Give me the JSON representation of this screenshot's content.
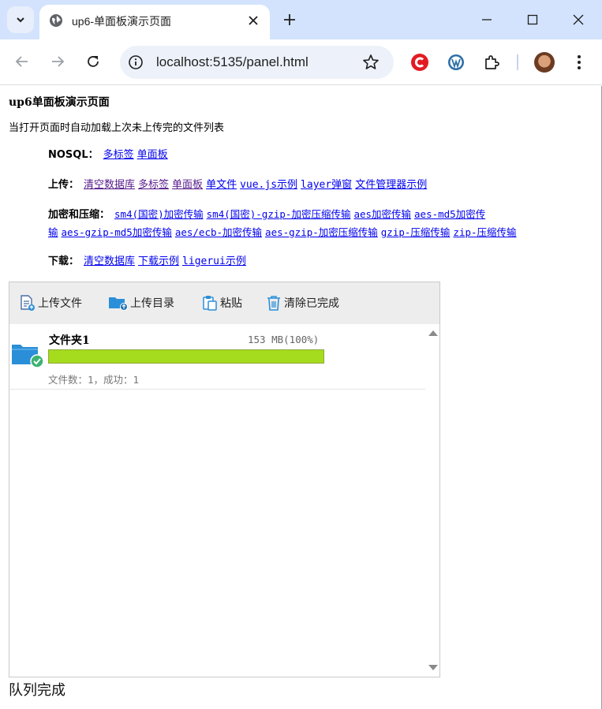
{
  "browser": {
    "tab_title": "up6-单面板演示页面",
    "url": "localhost:5135/panel.html"
  },
  "page": {
    "title": "up6单面板演示页面",
    "description": "当打开页面时自动加载上次未上传完的文件列表",
    "nosql": {
      "label": "NOSQL：",
      "links": [
        "多标签",
        "单面板"
      ]
    },
    "upload": {
      "label": "上传：",
      "links": [
        "清空数据库",
        "多标签",
        "单面板",
        "单文件",
        "vue.js示例",
        "layer弹窗",
        "文件管理器示例"
      ]
    },
    "encrypt": {
      "label": "加密和压缩：",
      "links_line1": [
        "sm4(国密)加密传输",
        "sm4(国密)-gzip-加密压缩传输",
        "aes加密传输",
        "aes-md5加密传"
      ],
      "links_line2": [
        "输",
        "aes-gzip-md5加密传输",
        "aes/ecb-加密传输",
        "aes-gzip-加密压缩传输",
        "gzip-压缩传输",
        "zip-压缩传输"
      ]
    },
    "download": {
      "label": "下载：",
      "links": [
        "清空数据库",
        "下载示例",
        "ligerui示例"
      ]
    }
  },
  "panel": {
    "buttons": {
      "upload_file": "上传文件",
      "upload_folder": "上传目录",
      "paste": "粘贴",
      "clear_done": "清除已完成"
    },
    "item": {
      "name": "文件夹1",
      "size": "153 MB(100%)",
      "progress": 1.0,
      "stats": "文件数：1，成功：1"
    }
  },
  "status": "队列完成",
  "colors": {
    "tabbar": "#d3e3fd",
    "progress": "#a5dc1e",
    "folder": "#2a8fd8",
    "success": "#3cb371"
  }
}
